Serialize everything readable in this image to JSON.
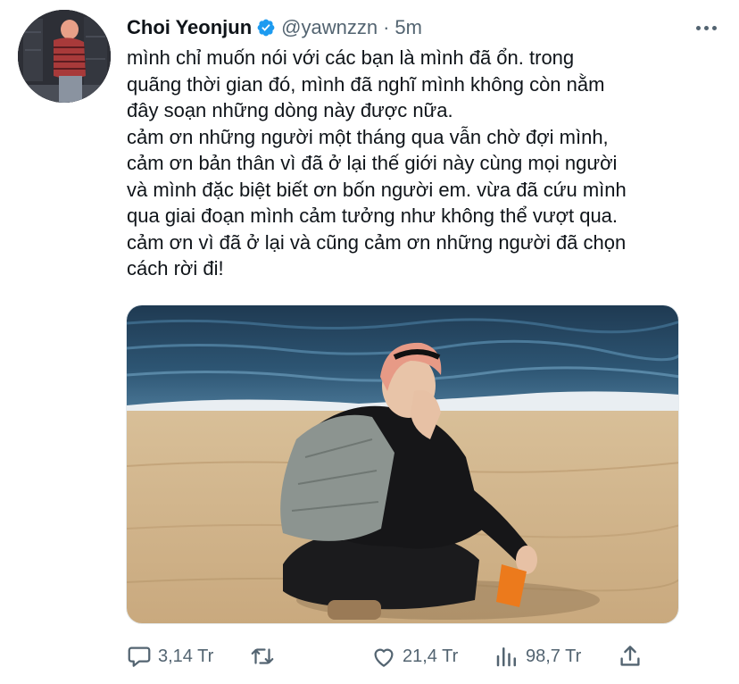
{
  "tweet": {
    "author": {
      "name": "Choi Yeonjun",
      "handle": "@yawnzzn",
      "verified": true
    },
    "separator": "·",
    "time": "5m",
    "text": "mình chỉ muốn nói với các bạn là mình đã ổn. trong\nquãng thời gian đó, mình đã nghĩ mình không còn nằm\nđây soạn những dòng này được nữa.\ncảm ơn những người một tháng qua vẫn chờ đợi mình,\ncảm ơn bản thân vì đã ở lại thế giới này cùng mọi người\nvà mình đặc biệt biết ơn bốn người em. vừa đã cứu mình\nqua giai đoạn mình cảm tưởng như không thể vượt qua.\ncảm ơn vì đã ở lại và cũng cảm ơn những người đã chọn\ncách rời đi!",
    "actions": {
      "replies": "3,14 Tr",
      "retweets": "",
      "likes": "21,4 Tr",
      "views": "98,7 Tr"
    }
  },
  "icons": {
    "verified": "verified-badge-icon",
    "more": "more-horizontal-icon",
    "reply": "reply-bubble-icon",
    "retweet": "retweet-icon",
    "like": "heart-icon",
    "views": "analytics-bars-icon",
    "share": "share-upload-icon"
  },
  "colors": {
    "text": "#0f1419",
    "secondary": "#536471",
    "verified": "#1d9bf0"
  }
}
